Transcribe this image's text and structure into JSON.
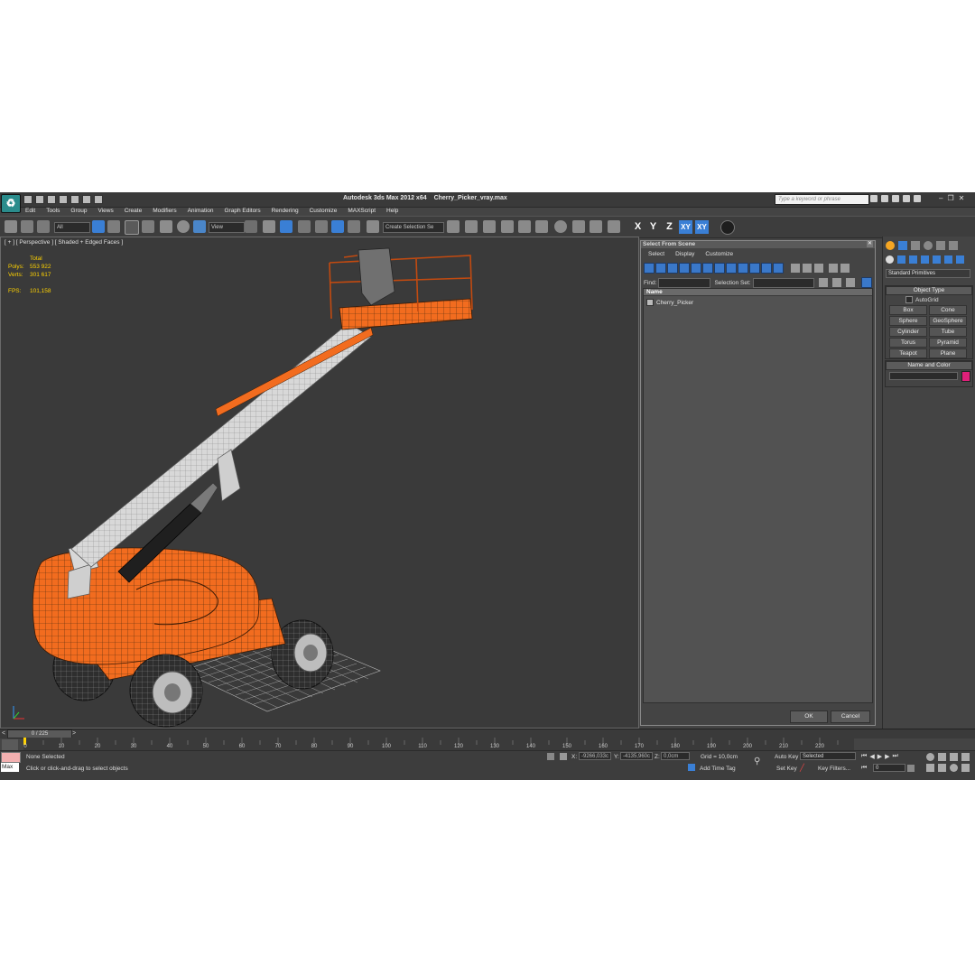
{
  "window": {
    "app_title": "Autodesk 3ds Max  2012 x64",
    "file_title": "Cherry_Picker_vray.max",
    "search_placeholder": "Type a keyword or phrase"
  },
  "menu": [
    "Edit",
    "Tools",
    "Group",
    "Views",
    "Create",
    "Modifiers",
    "Animation",
    "Graph Editors",
    "Rendering",
    "Customize",
    "MAXScript",
    "Help"
  ],
  "toolbar": {
    "selection_filter": "All",
    "ref_coord": "View",
    "named_selection": "Create Selection Se",
    "axis_x": "X",
    "axis_y": "Y",
    "axis_z": "Z",
    "axis_xy": "XY",
    "axis_xy2": "XY"
  },
  "viewport": {
    "label": "[ + ] [ Perspective ] [ Shaded + Edged Faces ]",
    "stats_header": "Total",
    "polys_label": "Polys:",
    "polys_value": "553 922",
    "verts_label": "Verts:",
    "verts_value": "301 617",
    "fps_label": "FPS:",
    "fps_value": "101,158"
  },
  "dialog": {
    "title": "Select From Scene",
    "menu": [
      "Select",
      "Display",
      "Customize"
    ],
    "find_label": "Find:",
    "selection_set_label": "Selection Set:",
    "column_name": "Name",
    "items": [
      "Cherry_Picker"
    ],
    "ok_label": "OK",
    "cancel_label": "Cancel"
  },
  "command_panel": {
    "category": "Standard Primitives",
    "object_type_header": "Object Type",
    "autogrid_label": "AutoGrid",
    "primitives": [
      "Box",
      "Cone",
      "Sphere",
      "GeoSphere",
      "Cylinder",
      "Tube",
      "Torus",
      "Pyramid",
      "Teapot",
      "Plane"
    ],
    "name_color_header": "Name and Color",
    "object_color": "#e0207a"
  },
  "timeline": {
    "frame_counter": "0 / 225",
    "ticks": [
      "0",
      "10",
      "20",
      "30",
      "40",
      "50",
      "60",
      "70",
      "80",
      "90",
      "100",
      "110",
      "120",
      "130",
      "140",
      "150",
      "160",
      "170",
      "180",
      "190",
      "200",
      "210",
      "220"
    ]
  },
  "status": {
    "maxscript": "Max",
    "selection": "None Selected",
    "prompt": "Click or click-and-drag to select objects",
    "x_label": "X:",
    "x_value": "-9266,033c",
    "y_label": "Y:",
    "y_value": "-4135,960c",
    "z_label": "Z:",
    "z_value": "0,0cm",
    "grid": "Grid = 10,0cm",
    "add_time_tag": "Add Time Tag",
    "auto_key": "Auto Key",
    "set_key": "Set Key",
    "key_mode": "Selected",
    "key_filters": "Key Filters...",
    "current_frame": "0"
  },
  "colors": {
    "machine_orange": "#f26c1f",
    "boom_white": "#d8d8d8",
    "viewport_bg": "#3a3a3a",
    "stats_yellow": "#ffd200"
  }
}
